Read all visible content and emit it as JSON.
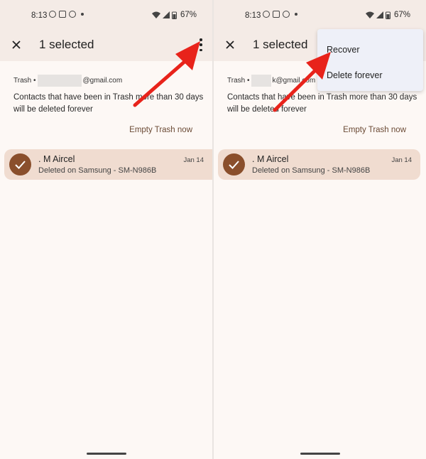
{
  "status_bar": {
    "time": "8:13",
    "battery": "67%"
  },
  "app_bar": {
    "title": "1 selected",
    "close_icon": "close-icon",
    "more_icon": "more-vert-icon"
  },
  "account": {
    "label": "Trash •",
    "email_suffix": "@gmail.com",
    "email_suffix_right": "k@gmail.com"
  },
  "notice": "Contacts that have been in Trash more than 30 days will be deleted forever",
  "empty_trash_label": "Empty Trash now",
  "contact": {
    "name": ". M Aircel",
    "subtitle": "Deleted on Samsung - SM-N986B",
    "date": "Jan 14"
  },
  "menu": {
    "items": [
      "Recover",
      "Delete forever"
    ]
  },
  "colors": {
    "accent": "#8a4f2c",
    "selected_row": "#f0dcd0",
    "header": "#f4ebe6",
    "annotation_arrow": "#e8231b"
  }
}
